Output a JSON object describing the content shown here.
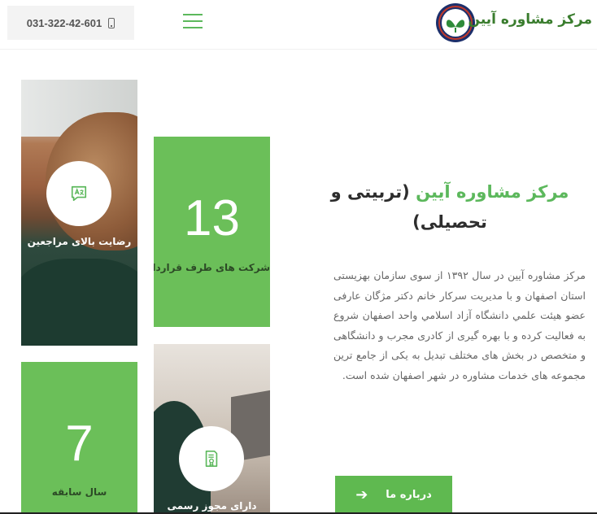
{
  "header": {
    "brand": "مرکز مشاوره آیین",
    "phone": "031-322-42-601",
    "menu_icon": "hamburger-icon",
    "phone_icon": "mobile-phone-icon"
  },
  "tiles": {
    "satisfaction_label": "رضایت بالای مراجعین",
    "satisfaction_icon": "translate-chat-icon",
    "contracts_number": "13",
    "contracts_label": "شرکت های طرف قرارداد",
    "years_number": "7",
    "years_label": "سال سابقه",
    "license_label": "دارای مجوز رسمی",
    "license_icon": "certificate-icon"
  },
  "intro": {
    "heading_accent": "مرکز مشاوره آیین",
    "heading_rest": " (تربیتی و تحصیلی)",
    "description": "مرکز مشاوره آیین در سال ۱۳۹۲ از سوی سازمان بهزیستی استان اصفهان و با مدیریت سرکار خانم دکتر مژگان عارفی عضو هیئت علمي دانشگاه آزاد اسلامي واحد اصفهان شروع به فعالیت کرده و با بهره گیری از کادری مجرب و دانشگاهی و متخصص در بخش های مختلف تبدیل به یکی از جامع ترین مجموعه های خدمات مشاوره در شهر اصفهان شده است.",
    "button_label": "درباره ما",
    "button_icon": "arrow-right-icon"
  },
  "colors": {
    "accent": "#5cb85c",
    "tile_green": "#6bbf59",
    "brand_text": "#3a7d2e"
  }
}
